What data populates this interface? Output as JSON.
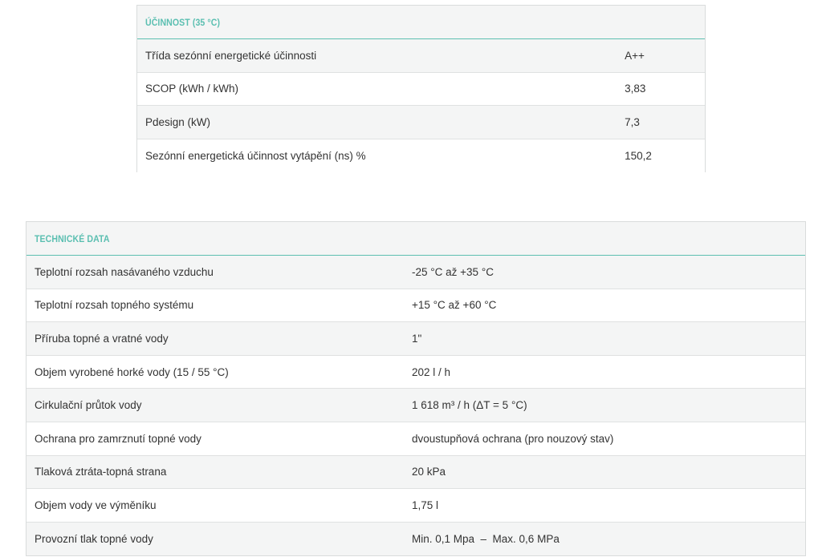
{
  "efficiency_table": {
    "title": "ÚČINNOST (35 °C)",
    "rows": [
      {
        "label": "Třída sezónní energetické účinnosti",
        "value": "A++"
      },
      {
        "label": "SCOP (kWh / kWh)",
        "value": "3,83"
      },
      {
        "label": "Pdesign (kW)",
        "value": "7,3"
      },
      {
        "label": "Sezónní energetická účinnost vytápění (ns) %",
        "value": "150,2"
      }
    ]
  },
  "technical_table": {
    "title": "TECHNICKÉ DATA",
    "rows": [
      {
        "label": "Teplotní rozsah nasávaného vzduchu",
        "value": "-25 °C až +35 °C"
      },
      {
        "label": "Teplotní rozsah topného systému",
        "value": "+15 °C až +60 °C"
      },
      {
        "label": "Příruba topné a vratné vody",
        "value": "1\""
      },
      {
        "label": "Objem vyrobené horké vody (15 / 55 °C)",
        "value": "202 l / h"
      },
      {
        "label": "Cirkulační průtok vody",
        "value": "1 618 m³ / h (ΔT = 5 °C)"
      },
      {
        "label": "Ochrana pro zamrznutí topné vody",
        "value": "dvoustupňová ochrana (pro nouzový stav)"
      },
      {
        "label": "Tlaková ztráta-topná strana",
        "value": "20 kPa"
      },
      {
        "label": "Objem vody ve výměníku",
        "value": "1,75 l"
      },
      {
        "label": "Provozní tlak topné vody",
        "value": "Min. 0,1 Mpa  –  Max. 0,6 MPa"
      }
    ]
  },
  "colors": {
    "accent": "#5bbfb1",
    "header_bg": "#f4f5f5",
    "border": "#d9dcdc",
    "text": "#333333"
  }
}
